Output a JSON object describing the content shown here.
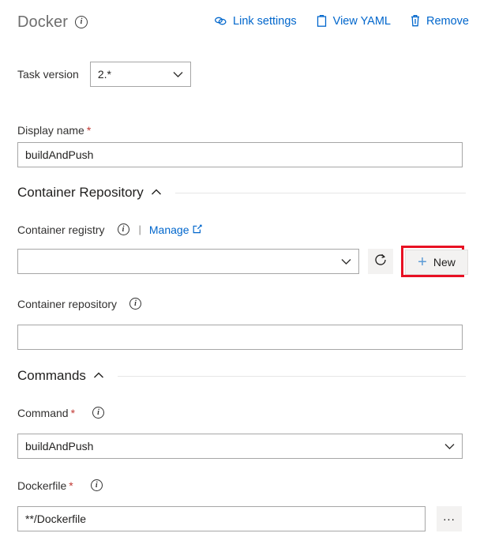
{
  "header": {
    "title": "Docker",
    "info_icon": "info-icon",
    "toolbar": [
      {
        "label": "Link settings",
        "icon": "link-icon"
      },
      {
        "label": "View YAML",
        "icon": "clipboard-icon"
      },
      {
        "label": "Remove",
        "icon": "trash-icon"
      }
    ]
  },
  "task_version": {
    "label": "Task version",
    "value": "2.*",
    "chevron": "chevron-down-icon"
  },
  "display_name": {
    "label": "Display name",
    "required": "*",
    "value": "buildAndPush",
    "placeholder": ""
  },
  "sections": {
    "container_repository": {
      "title": "Container Repository",
      "chevron": "chevron-up-icon"
    },
    "commands": {
      "title": "Commands",
      "chevron": "chevron-up-icon"
    }
  },
  "container_registry": {
    "label": "Container registry",
    "info_icon": "info-icon",
    "separator": "|",
    "manage_label": "Manage",
    "external_icon": "external-link-icon",
    "value": "",
    "placeholder": "",
    "chevron": "chevron-down-icon",
    "refresh_icon": "refresh-icon",
    "new_label": "New",
    "plus_icon": "plus-icon",
    "highlight_color": "#e81123"
  },
  "container_repository_field": {
    "label": "Container repository",
    "info_icon": "info-icon",
    "value": "",
    "placeholder": ""
  },
  "command": {
    "label": "Command",
    "required": "*",
    "info_icon": "info-icon",
    "value": "buildAndPush",
    "chevron": "chevron-down-icon"
  },
  "dockerfile": {
    "label": "Dockerfile",
    "required": "*",
    "info_icon": "info-icon",
    "value": "**/Dockerfile",
    "browse_label": "...",
    "browse_icon": "ellipsis-icon"
  },
  "colors": {
    "link": "#0066cc",
    "accent_plus": "#5b9bd5",
    "required": "#c23934",
    "highlight": "#e81123",
    "title_gray": "#6e6e6e",
    "border": "#a6a6a6"
  }
}
